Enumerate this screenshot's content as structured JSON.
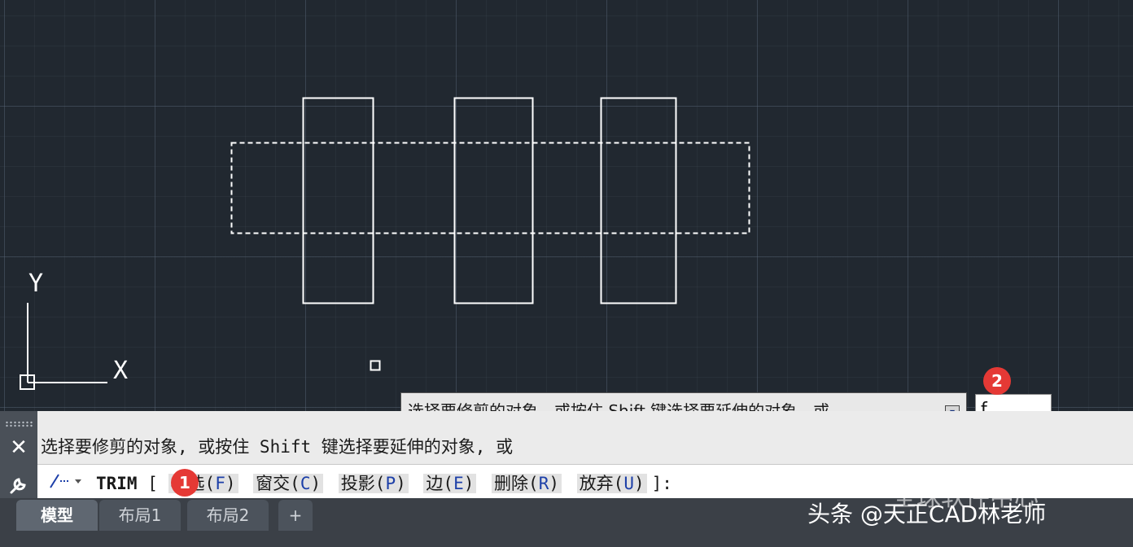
{
  "ucs": {
    "y_label": "Y",
    "x_label": "X"
  },
  "tooltip": {
    "text": "选择要修剪的对象，或按住 Shift 键选择要延伸的对象，或",
    "icon": "expand-options-icon"
  },
  "dynamic_input": {
    "value": "f"
  },
  "callouts": {
    "one": "1",
    "two": "2"
  },
  "command": {
    "history": "选择要修剪的对象, 或按住 Shift 键选择要延伸的对象, 或",
    "name": "TRIM",
    "open_bracket": "[",
    "options": [
      {
        "label": "栏选",
        "key": "F"
      },
      {
        "label": "窗交",
        "key": "C"
      },
      {
        "label": "投影",
        "key": "P"
      },
      {
        "label": "边",
        "key": "E"
      },
      {
        "label": "删除",
        "key": "R"
      },
      {
        "label": "放弃",
        "key": "U"
      }
    ],
    "close": "]:"
  },
  "tabs": [
    {
      "label": "模型",
      "active": true
    },
    {
      "label": "布局1",
      "active": false
    },
    {
      "label": "布局2",
      "active": false
    },
    {
      "label": "+",
      "active": false
    }
  ],
  "watermark": {
    "line1": "头条 @天正CAD林老师",
    "line2": "全球软件中心"
  },
  "colors": {
    "canvas_bg": "#212830",
    "callout_red": "#e53935",
    "option_key": "#1c3fa8"
  }
}
